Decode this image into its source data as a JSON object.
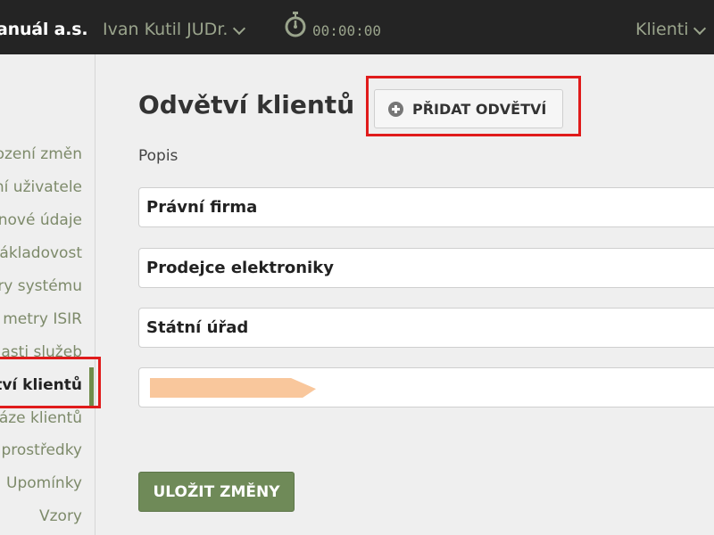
{
  "topbar": {
    "company": "anuál a.s.",
    "user": "Ivan Kutil JUDr.",
    "timer": "00:00:00",
    "clients_menu": "Klienti"
  },
  "sidebar": {
    "items": [
      {
        "label": "ození změn"
      },
      {
        "label": "ní uživatele"
      },
      {
        "label": "nové údaje"
      },
      {
        "label": "ákladovost"
      },
      {
        "label": "ry systému"
      },
      {
        "label": "metry ISIR"
      },
      {
        "label": "asti služeb"
      },
      {
        "label": "vtví klientů",
        "active": true
      },
      {
        "label": "áze klientů"
      },
      {
        "label": "prostředky"
      },
      {
        "label": "Upomínky"
      },
      {
        "label": "Vzory"
      }
    ]
  },
  "main": {
    "title": "Odvětví klientů",
    "add_button": "PŘIDAT ODVĚTVÍ",
    "field_label": "Popis",
    "fields": [
      {
        "value": "Právní firma"
      },
      {
        "value": "Prodejce elektroniky"
      },
      {
        "value": "Státní úřad"
      },
      {
        "value": ""
      }
    ],
    "save_button": "ULOŽIT ZMĚNY"
  },
  "colors": {
    "topbar_bg": "#242424",
    "accent_green": "#6f8a58",
    "muted_green_text": "#7d8a6a",
    "highlight_red": "#e01b1b",
    "redaction": "#f9c79c"
  },
  "icons": [
    "chevron-down-icon",
    "stopwatch-icon",
    "plus-circle-icon"
  ]
}
